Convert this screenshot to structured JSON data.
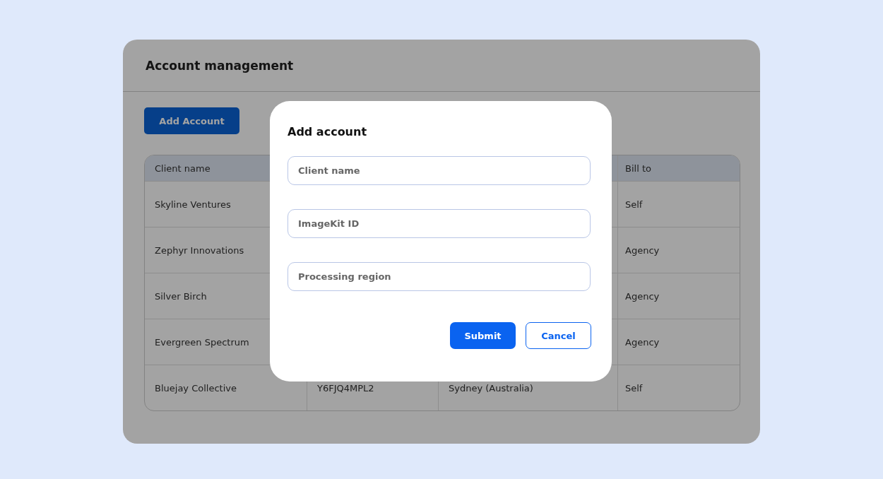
{
  "page": {
    "title": "Account management"
  },
  "add_button": {
    "label": "Add Account"
  },
  "table": {
    "columns": [
      {
        "header": "Client name"
      },
      {
        "header": "Bill to"
      }
    ],
    "rows": [
      {
        "client_name": "Skyline Ventures",
        "bill_to": "Self"
      },
      {
        "client_name": "Zephyr Innovations",
        "bill_to": "Agency"
      },
      {
        "client_name": "Silver Birch",
        "bill_to": "Agency"
      },
      {
        "client_name": "Evergreen Spectrum",
        "bill_to": "Agency"
      },
      {
        "client_name": "Bluejay Collective",
        "column_2": "Y6FJQ4MPL2",
        "column_3": "Sydney (Australia)",
        "bill_to": "Self"
      }
    ]
  },
  "modal": {
    "title": "Add account",
    "fields": [
      {
        "placeholder": "Client name"
      },
      {
        "placeholder": "ImageKit ID"
      },
      {
        "placeholder": "Processing region"
      }
    ],
    "buttons": [
      {
        "label": "Submit",
        "kind": "primary"
      },
      {
        "label": "Cancel",
        "kind": "secondary"
      }
    ]
  }
}
